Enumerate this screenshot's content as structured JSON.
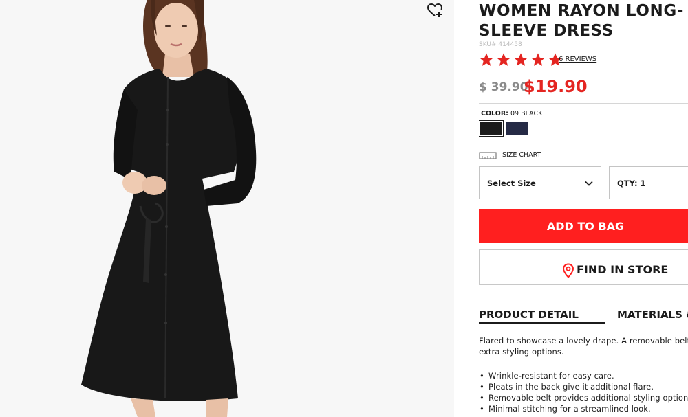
{
  "product": {
    "title": "WOMEN RAYON LONG-SLEEVE DRESS",
    "sku_label": "SKU#",
    "sku": "414458",
    "rating": 5,
    "reviews_link": "6 REVIEWS",
    "price_original": "$ 39.90",
    "price_sale": "$19.90",
    "color_label": "COLOR:",
    "color_value": "09 BLACK",
    "swatches": [
      {
        "name": "black",
        "hex": "#1b1b1b"
      },
      {
        "name": "navy",
        "hex": "#252a45"
      }
    ]
  },
  "controls": {
    "size_chart": "SIZE CHART",
    "size_select": "Select Size",
    "qty_label": "QTY: 1",
    "add_to_bag": "ADD TO BAG",
    "find_in_store": "FIND IN STORE"
  },
  "tabs": {
    "product_detail": "PRODUCT DETAIL",
    "materials": "MATERIALS &"
  },
  "description": {
    "line1": "Flared to showcase a lovely drape. A removable belt",
    "line2": "extra styling options.",
    "bullets": [
      "Wrinkle-resistant for easy care.",
      "Pleats in the back give it additional flare.",
      "Removable belt provides additional styling options.",
      "Minimal stitching for a streamlined look."
    ]
  },
  "colors": {
    "accent_red": "#ff1f1f",
    "sale_red": "#e42521",
    "star_red": "#e42521"
  },
  "icons": [
    "heart-plus-icon",
    "star-icon",
    "ruler-icon",
    "chevron-down-icon",
    "location-pin-icon"
  ]
}
